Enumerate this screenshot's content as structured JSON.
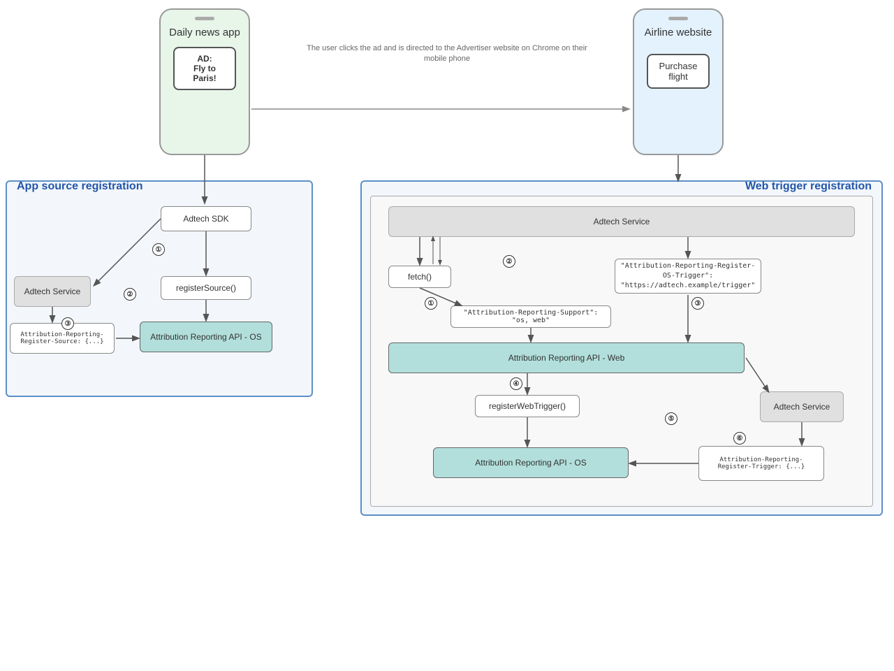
{
  "phones": {
    "left": {
      "title": "Daily news app",
      "ad_label": "AD:\nFly to Paris!"
    },
    "right": {
      "title": "Airline website",
      "cta_label": "Purchase flight"
    }
  },
  "arrow_label": "The user clicks the ad and is directed to the Advertiser website on Chrome on their mobile phone",
  "sections": {
    "app_source": {
      "label": "App source registration"
    },
    "web_trigger": {
      "label": "Web trigger registration"
    }
  },
  "app_source_boxes": {
    "adtech_sdk": "Adtech SDK",
    "adtech_service": "Adtech Service",
    "register_source": "registerSource()",
    "attribution_os": "Attribution Reporting API - OS",
    "attribution_register": "Attribution-Reporting-Register-Source: {...}"
  },
  "web_trigger_boxes": {
    "adtech_service_top": "Adtech Service",
    "fetch": "fetch()",
    "attribution_reporting_support": "\"Attribution-Reporting-Support\": \"os, web\"",
    "attribution_os_trigger": "\"Attribution-Reporting-Register-OS-Trigger\":\n\"https://adtech.example/trigger\"",
    "attribution_web": "Attribution Reporting API - Web",
    "register_web_trigger": "registerWebTrigger()",
    "adtech_service_bottom": "Adtech Service",
    "attribution_os_bottom": "Attribution Reporting API - OS",
    "attribution_register_trigger": "Attribution-Reporting-Register-Trigger: {...}"
  },
  "step_numbers": [
    "①",
    "②",
    "③",
    "④",
    "⑤",
    "⑥"
  ]
}
